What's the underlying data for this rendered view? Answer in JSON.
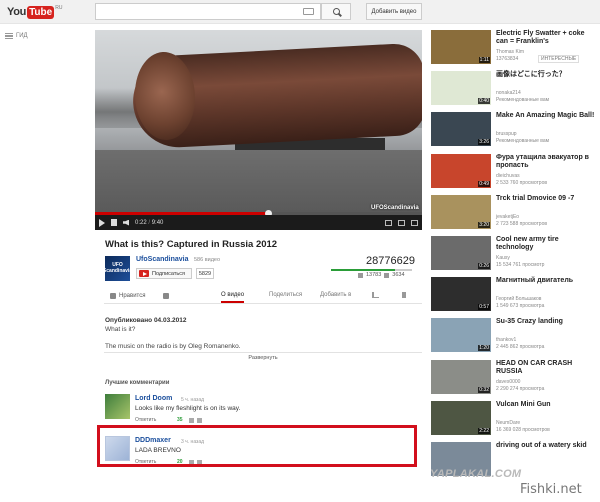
{
  "masthead": {
    "logo_you": "You",
    "logo_tube": "Tube",
    "logo_region": "RU",
    "search_placeholder": "",
    "upload_label": "Добавить видео"
  },
  "guide": {
    "label": "ГИД"
  },
  "player": {
    "watermark": "UFOScandinavia",
    "current_time": "0:22",
    "duration": "9:40",
    "progress": 0.53
  },
  "video": {
    "title": "What is this? Captured in Russia 2012",
    "channel_logo_text": "UFO Scandinavia",
    "channel": "UfoScandinavia",
    "video_count": "586 видео",
    "subscribe_label": "Подписаться",
    "subscriber_count": "5829",
    "views": "28776629",
    "likes": "13783",
    "dislikes": "3634",
    "like_ratio": 0.79,
    "like_label": "Нравится",
    "tabs": [
      "О видео",
      "Поделиться",
      "Добавить в"
    ],
    "published": "Опубликовано 04.03.2012",
    "description": [
      "What is it?",
      "The music on the radio is by Oleg Romanenko."
    ],
    "expand_label": "Развернуть"
  },
  "comments": {
    "heading": "Лучшие комментарии",
    "items": [
      {
        "author": "Lord Doom",
        "time": "5 ч. назад",
        "text": "Looks like my fleshlight is on its way.",
        "reply": "Ответить",
        "votes": "35"
      },
      {
        "author": "DDDmaxer",
        "time": "3 ч. назад",
        "text": "LADA BREVNO",
        "reply": "Ответить",
        "votes": "20"
      }
    ]
  },
  "related": [
    {
      "title": "Electric Fly Swatter + coke can = Franklin's",
      "meta1": "Thomas Kim",
      "meta2": "13763834",
      "badge": "ИНТЕРЕСНЫЕ",
      "duration": "1:11",
      "thumb": "#8a6d3b"
    },
    {
      "title": "画像はどこに行った？",
      "meta1": "nonaka214",
      "meta2": "Рекомендованные вам",
      "badge": "",
      "duration": "0:40",
      "thumb": "#dfe8d4"
    },
    {
      "title": "Make An Amazing Magic Ball!",
      "meta1": "brusspup",
      "meta2": "Рекомендованные вам",
      "badge": "",
      "duration": "3:26",
      "thumb": "#3a4752"
    },
    {
      "title": "Фура утащила эвакуатор в пропасть",
      "meta1": "dieichuvas",
      "meta2": "2 533 760 просмотров",
      "badge": "",
      "duration": "0:49",
      "thumb": "#c8452c"
    },
    {
      "title": "Trck trial Dmovice 09 -7",
      "meta1": "jevaketjEo",
      "meta2": "2 723 588 просмотров",
      "badge": "",
      "duration": "3:20",
      "thumb": "#a9925e"
    },
    {
      "title": "Cool new army tire technology",
      "meta1": "Kausy",
      "meta2": "15 534 761 просмотр",
      "badge": "",
      "duration": "0:26",
      "thumb": "#6b6b6b"
    },
    {
      "title": "Магнитный двигатель",
      "meta1": "Георгий Большаков",
      "meta2": "1 549 673 просмотра",
      "badge": "",
      "duration": "0:57",
      "thumb": "#2d2d2d"
    },
    {
      "title": "Su-35 Crazy landing",
      "meta1": "thankov1",
      "meta2": "2 445 862 просмотра",
      "badge": "",
      "duration": "1:20",
      "thumb": "#8aa3b5"
    },
    {
      "title": "HEAD ON CAR CRASH RUSSIA",
      "meta1": "daves0000",
      "meta2": "2 290 274 просмотра",
      "badge": "",
      "duration": "0:32",
      "thumb": "#8b8d88"
    },
    {
      "title": "Vulcan Mini Gun",
      "meta1": "NeumDare",
      "meta2": "16 369 028 просмотров",
      "badge": "",
      "duration": "2:22",
      "thumb": "#4e5643"
    },
    {
      "title": "driving out of a watery skid",
      "meta1": "",
      "meta2": "",
      "badge": "",
      "duration": "",
      "thumb": "#7b8a99"
    }
  ],
  "watermarks": {
    "site1": "YAPLAKAL.COM",
    "site2": "Fishki.net"
  },
  "colors": {
    "youtube_red": "#d6231e",
    "highlight_red": "#d20f1c",
    "like_green": "#2a9d38",
    "link_blue": "#1a4e9c"
  }
}
